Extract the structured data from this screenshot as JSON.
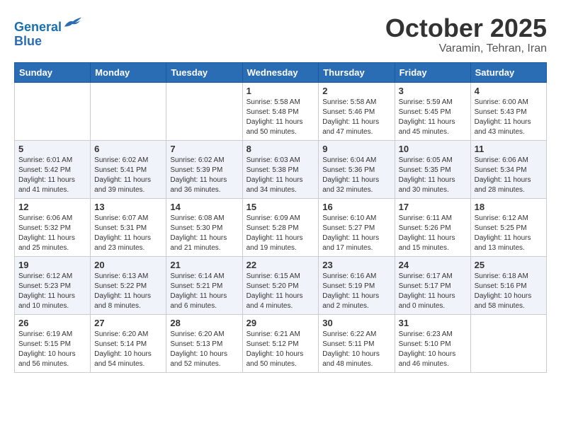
{
  "header": {
    "logo_line1": "General",
    "logo_line2": "Blue",
    "month": "October 2025",
    "location": "Varamin, Tehran, Iran"
  },
  "weekdays": [
    "Sunday",
    "Monday",
    "Tuesday",
    "Wednesday",
    "Thursday",
    "Friday",
    "Saturday"
  ],
  "weeks": [
    [
      {
        "day": "",
        "info": ""
      },
      {
        "day": "",
        "info": ""
      },
      {
        "day": "",
        "info": ""
      },
      {
        "day": "1",
        "info": "Sunrise: 5:58 AM\nSunset: 5:48 PM\nDaylight: 11 hours\nand 50 minutes."
      },
      {
        "day": "2",
        "info": "Sunrise: 5:58 AM\nSunset: 5:46 PM\nDaylight: 11 hours\nand 47 minutes."
      },
      {
        "day": "3",
        "info": "Sunrise: 5:59 AM\nSunset: 5:45 PM\nDaylight: 11 hours\nand 45 minutes."
      },
      {
        "day": "4",
        "info": "Sunrise: 6:00 AM\nSunset: 5:43 PM\nDaylight: 11 hours\nand 43 minutes."
      }
    ],
    [
      {
        "day": "5",
        "info": "Sunrise: 6:01 AM\nSunset: 5:42 PM\nDaylight: 11 hours\nand 41 minutes."
      },
      {
        "day": "6",
        "info": "Sunrise: 6:02 AM\nSunset: 5:41 PM\nDaylight: 11 hours\nand 39 minutes."
      },
      {
        "day": "7",
        "info": "Sunrise: 6:02 AM\nSunset: 5:39 PM\nDaylight: 11 hours\nand 36 minutes."
      },
      {
        "day": "8",
        "info": "Sunrise: 6:03 AM\nSunset: 5:38 PM\nDaylight: 11 hours\nand 34 minutes."
      },
      {
        "day": "9",
        "info": "Sunrise: 6:04 AM\nSunset: 5:36 PM\nDaylight: 11 hours\nand 32 minutes."
      },
      {
        "day": "10",
        "info": "Sunrise: 6:05 AM\nSunset: 5:35 PM\nDaylight: 11 hours\nand 30 minutes."
      },
      {
        "day": "11",
        "info": "Sunrise: 6:06 AM\nSunset: 5:34 PM\nDaylight: 11 hours\nand 28 minutes."
      }
    ],
    [
      {
        "day": "12",
        "info": "Sunrise: 6:06 AM\nSunset: 5:32 PM\nDaylight: 11 hours\nand 25 minutes."
      },
      {
        "day": "13",
        "info": "Sunrise: 6:07 AM\nSunset: 5:31 PM\nDaylight: 11 hours\nand 23 minutes."
      },
      {
        "day": "14",
        "info": "Sunrise: 6:08 AM\nSunset: 5:30 PM\nDaylight: 11 hours\nand 21 minutes."
      },
      {
        "day": "15",
        "info": "Sunrise: 6:09 AM\nSunset: 5:28 PM\nDaylight: 11 hours\nand 19 minutes."
      },
      {
        "day": "16",
        "info": "Sunrise: 6:10 AM\nSunset: 5:27 PM\nDaylight: 11 hours\nand 17 minutes."
      },
      {
        "day": "17",
        "info": "Sunrise: 6:11 AM\nSunset: 5:26 PM\nDaylight: 11 hours\nand 15 minutes."
      },
      {
        "day": "18",
        "info": "Sunrise: 6:12 AM\nSunset: 5:25 PM\nDaylight: 11 hours\nand 13 minutes."
      }
    ],
    [
      {
        "day": "19",
        "info": "Sunrise: 6:12 AM\nSunset: 5:23 PM\nDaylight: 11 hours\nand 10 minutes."
      },
      {
        "day": "20",
        "info": "Sunrise: 6:13 AM\nSunset: 5:22 PM\nDaylight: 11 hours\nand 8 minutes."
      },
      {
        "day": "21",
        "info": "Sunrise: 6:14 AM\nSunset: 5:21 PM\nDaylight: 11 hours\nand 6 minutes."
      },
      {
        "day": "22",
        "info": "Sunrise: 6:15 AM\nSunset: 5:20 PM\nDaylight: 11 hours\nand 4 minutes."
      },
      {
        "day": "23",
        "info": "Sunrise: 6:16 AM\nSunset: 5:19 PM\nDaylight: 11 hours\nand 2 minutes."
      },
      {
        "day": "24",
        "info": "Sunrise: 6:17 AM\nSunset: 5:17 PM\nDaylight: 11 hours\nand 0 minutes."
      },
      {
        "day": "25",
        "info": "Sunrise: 6:18 AM\nSunset: 5:16 PM\nDaylight: 10 hours\nand 58 minutes."
      }
    ],
    [
      {
        "day": "26",
        "info": "Sunrise: 6:19 AM\nSunset: 5:15 PM\nDaylight: 10 hours\nand 56 minutes."
      },
      {
        "day": "27",
        "info": "Sunrise: 6:20 AM\nSunset: 5:14 PM\nDaylight: 10 hours\nand 54 minutes."
      },
      {
        "day": "28",
        "info": "Sunrise: 6:20 AM\nSunset: 5:13 PM\nDaylight: 10 hours\nand 52 minutes."
      },
      {
        "day": "29",
        "info": "Sunrise: 6:21 AM\nSunset: 5:12 PM\nDaylight: 10 hours\nand 50 minutes."
      },
      {
        "day": "30",
        "info": "Sunrise: 6:22 AM\nSunset: 5:11 PM\nDaylight: 10 hours\nand 48 minutes."
      },
      {
        "day": "31",
        "info": "Sunrise: 6:23 AM\nSunset: 5:10 PM\nDaylight: 10 hours\nand 46 minutes."
      },
      {
        "day": "",
        "info": ""
      }
    ]
  ]
}
